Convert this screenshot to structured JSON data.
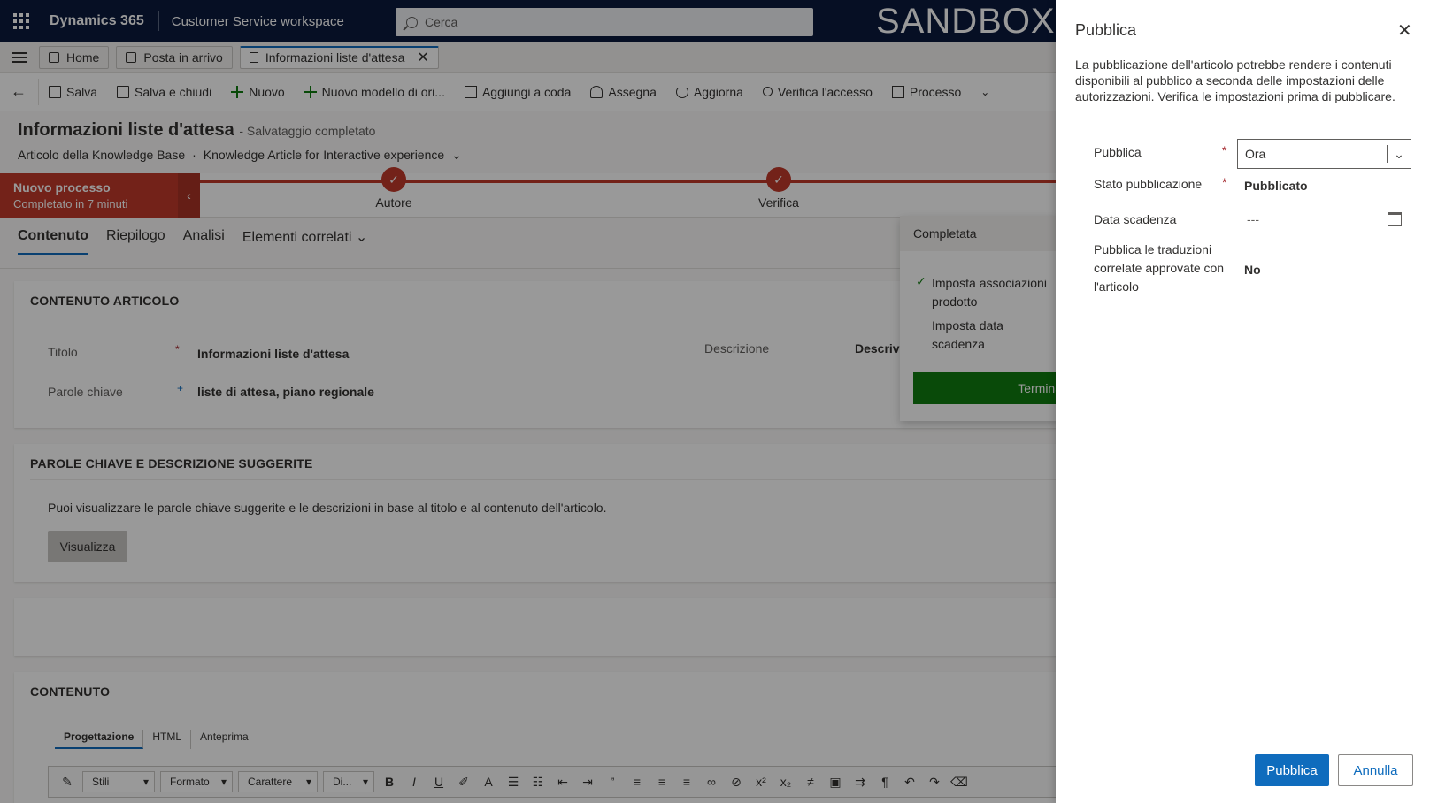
{
  "topbar": {
    "brand": "Dynamics 365",
    "app_name": "Customer Service workspace",
    "search_placeholder": "Cerca",
    "environment_label": "SANDBOX"
  },
  "session_tabs": [
    {
      "label": "Home",
      "icon": "home-icon"
    },
    {
      "label": "Posta in arrivo",
      "icon": "inbox-icon"
    },
    {
      "label": "Informazioni liste d'attesa",
      "icon": "article-icon",
      "active": true
    }
  ],
  "commands": [
    {
      "label": "Salva",
      "icon": "save-icon"
    },
    {
      "label": "Salva e chiudi",
      "icon": "save-close-icon"
    },
    {
      "label": "Nuovo",
      "icon": "plus-icon"
    },
    {
      "label": "Nuovo modello di ori...",
      "icon": "plus-icon"
    },
    {
      "label": "Aggiungi a coda",
      "icon": "queue-icon"
    },
    {
      "label": "Assegna",
      "icon": "person-icon"
    },
    {
      "label": "Aggiorna",
      "icon": "refresh-icon"
    },
    {
      "label": "Verifica l'accesso",
      "icon": "key-icon"
    },
    {
      "label": "Processo",
      "icon": "process-icon"
    }
  ],
  "record": {
    "title": "Informazioni liste d'attesa",
    "save_status": "- Salvataggio completato",
    "entity": "Articolo della Knowledge Base",
    "separator": "·",
    "form": "Knowledge Article for Interactive experience"
  },
  "bpf": {
    "process_name": "Nuovo processo",
    "process_status": "Completato in 7 minuti",
    "stages": [
      "Autore",
      "Verifica"
    ],
    "accent_color": "#c0392b"
  },
  "form_tabs": [
    "Contenuto",
    "Riepilogo",
    "Analisi",
    "Elementi correlati"
  ],
  "section_article": {
    "heading": "CONTENUTO ARTICOLO",
    "title_label": "Titolo",
    "title_value": "Informazioni liste d'attesa",
    "keywords_label": "Parole chiave",
    "keywords_value": "liste di attesa, piano regionale",
    "description_label": "Descrizione",
    "description_value": "Descrive"
  },
  "section_suggest": {
    "heading": "PAROLE CHIAVE E DESCRIZIONE SUGGERITE",
    "text": "Puoi visualizzare le parole chiave suggerite e le descrizioni in base al titolo e al contenuto dell'articolo.",
    "button": "Visualizza"
  },
  "section_content": {
    "heading": "CONTENUTO",
    "editor_tabs": [
      "Progettazione",
      "HTML",
      "Anteprima"
    ],
    "toolbar_dropdowns": [
      "Stili",
      "Formato",
      "Carattere",
      "Di..."
    ]
  },
  "flyout": {
    "header": "Completata",
    "items": [
      "Imposta associazioni prodotto",
      "Imposta data scadenza"
    ],
    "button": "Termina"
  },
  "panel": {
    "title": "Pubblica",
    "description": "La pubblicazione dell'articolo potrebbe rendere i contenuti disponibili al pubblico a seconda delle impostazioni delle autorizzazioni. Verifica le impostazioni prima di pubblicare.",
    "publish_label": "Pubblica",
    "publish_value": "Ora",
    "state_label": "Stato pubblicazione",
    "state_value": "Pubblicato",
    "expiry_label": "Data scadenza",
    "expiry_value": "---",
    "translations_label": "Pubblica le traduzioni correlate approvate con l'articolo",
    "translations_value": "No",
    "primary_button": "Pubblica",
    "secondary_button": "Annulla",
    "primary_color": "#0f6cbd"
  }
}
